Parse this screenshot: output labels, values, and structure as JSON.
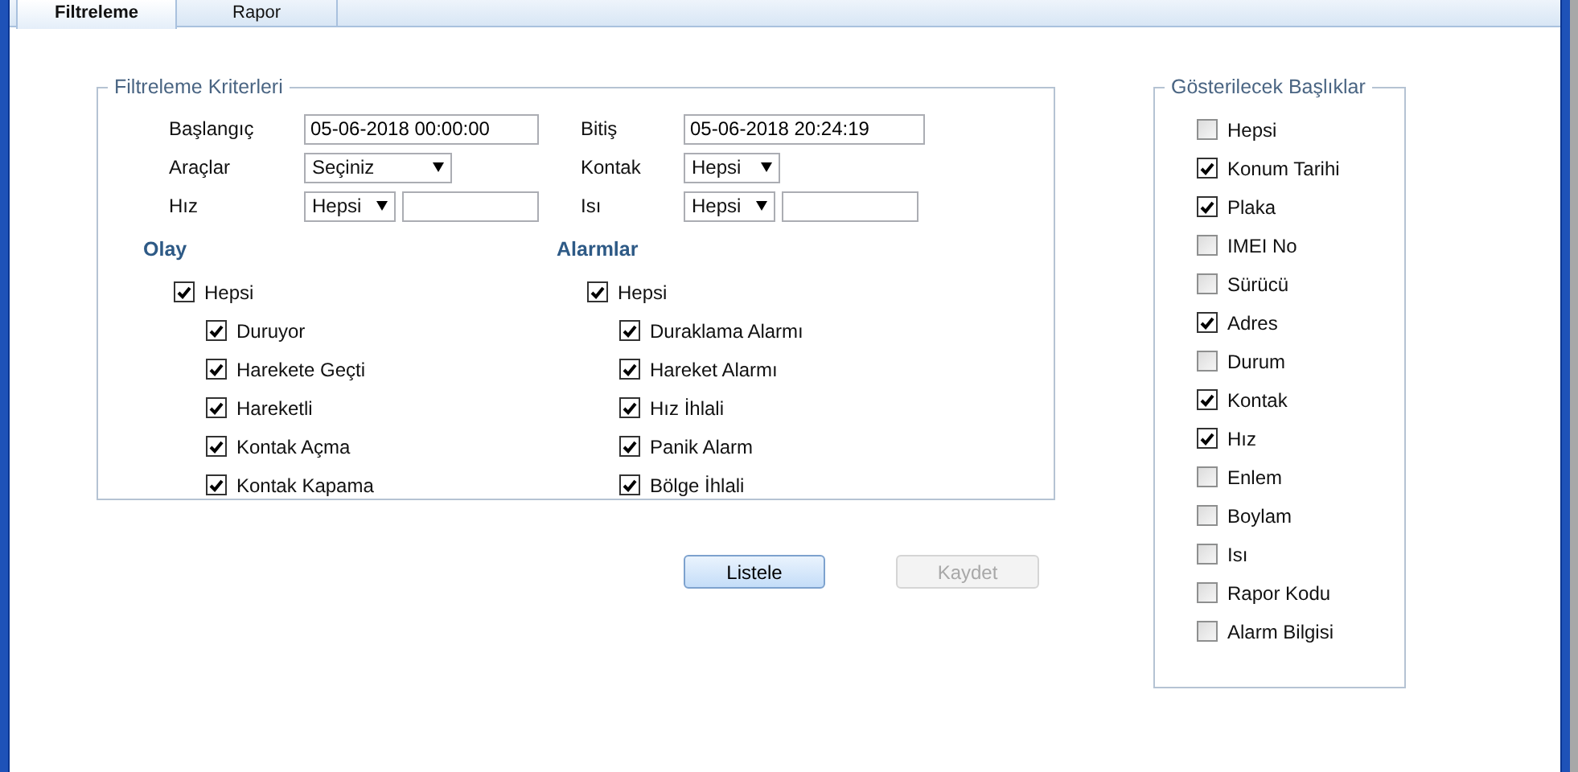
{
  "tabs": [
    {
      "label": "Filtreleme",
      "selected": true
    },
    {
      "label": "Rapor",
      "selected": false
    }
  ],
  "filter_panel": {
    "legend": "Filtreleme Kriterleri",
    "fields": [
      {
        "label": "Başlangıç",
        "kind": "text",
        "value": "05-06-2018 00:00:00"
      },
      {
        "label": "Bitiş",
        "kind": "text",
        "value": "05-06-2018 20:24:19"
      },
      {
        "label": "Araçlar",
        "kind": "select_wide",
        "value": "Seçiniz"
      },
      {
        "label": "Kontak",
        "kind": "select",
        "value": "Hepsi"
      },
      {
        "label": "Hız",
        "kind": "select_with_input",
        "value": "Hepsi"
      },
      {
        "label": "Isı",
        "kind": "select_with_input",
        "value": "Hepsi"
      }
    ],
    "groups": [
      {
        "title": "Olay",
        "all": {
          "label": "Hepsi",
          "checked": true
        },
        "items": [
          {
            "label": "Duruyor",
            "checked": true
          },
          {
            "label": "Harekete Geçti",
            "checked": true
          },
          {
            "label": "Hareketli",
            "checked": true
          },
          {
            "label": "Kontak Açma",
            "checked": true
          },
          {
            "label": "Kontak Kapama",
            "checked": true
          }
        ]
      },
      {
        "title": "Alarmlar",
        "all": {
          "label": "Hepsi",
          "checked": true
        },
        "items": [
          {
            "label": "Duraklama Alarmı",
            "checked": true
          },
          {
            "label": "Hareket Alarmı",
            "checked": true
          },
          {
            "label": "Hız İhlali",
            "checked": true
          },
          {
            "label": "Panik Alarm",
            "checked": true
          },
          {
            "label": "Bölge İhlali",
            "checked": true
          }
        ]
      }
    ]
  },
  "buttons": [
    {
      "label": "Listele",
      "disabled": false
    },
    {
      "label": "Kaydet",
      "disabled": true
    }
  ],
  "columns_panel": {
    "legend": "Gösterilecek Başlıklar",
    "items": [
      {
        "label": "Hepsi",
        "checked": false
      },
      {
        "label": "Konum Tarihi",
        "checked": true
      },
      {
        "label": "Plaka",
        "checked": true
      },
      {
        "label": "IMEI No",
        "checked": false
      },
      {
        "label": "Sürücü",
        "checked": false
      },
      {
        "label": "Adres",
        "checked": true
      },
      {
        "label": "Durum",
        "checked": false
      },
      {
        "label": "Kontak",
        "checked": true
      },
      {
        "label": "Hız",
        "checked": true
      },
      {
        "label": "Enlem",
        "checked": false
      },
      {
        "label": "Boylam",
        "checked": false
      },
      {
        "label": "Isı",
        "checked": false
      },
      {
        "label": "Rapor Kodu",
        "checked": false
      },
      {
        "label": "Alarm Bilgisi",
        "checked": false
      }
    ]
  }
}
